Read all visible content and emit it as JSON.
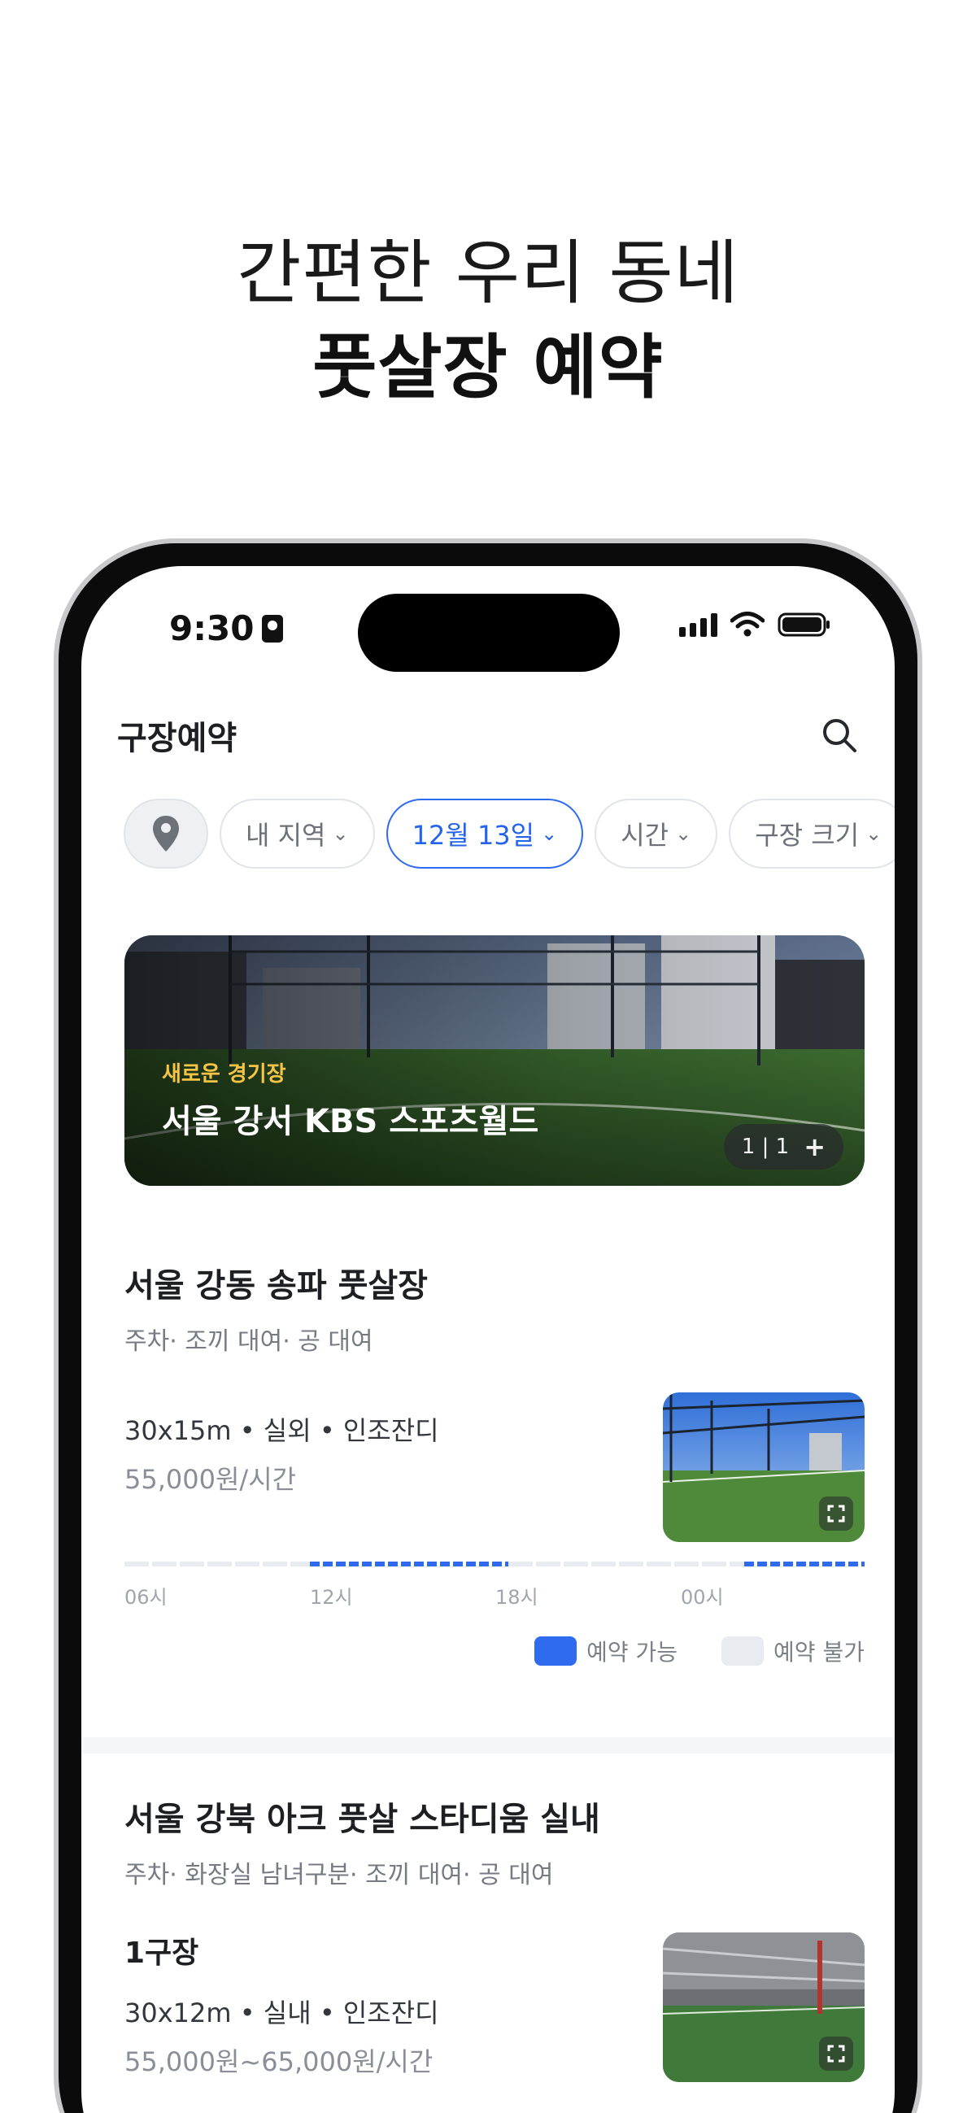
{
  "promo": {
    "line1": "간편한 우리 동네",
    "line2": "풋살장 예약"
  },
  "status_bar": {
    "time": "9:30"
  },
  "app": {
    "title": "구장예약",
    "filters": [
      {
        "label": "내 지역",
        "active": false
      },
      {
        "label": "12월 13일",
        "active": true
      },
      {
        "label": "시간",
        "active": false
      },
      {
        "label": "구장 크기",
        "active": false
      }
    ],
    "chevron": "⌄"
  },
  "banner": {
    "tag": "새로운 경기장",
    "name": "서울 강서 KBS 스포츠월드",
    "counter": "1 | 1",
    "plus": "+"
  },
  "venues": [
    {
      "name": "서울 강동 송파 풋살장",
      "amenities": "주차· 조끼 대여· 공 대여",
      "spec": "30x15m • 실외 • 인조잔디",
      "price": "55,000원/시간",
      "timeline_labels": [
        "06시",
        "12시",
        "18시",
        "00시"
      ],
      "legend": {
        "available": "예약 가능",
        "unavailable": "예약 불가"
      }
    },
    {
      "name": "서울 강북 아크 풋살 스타디움 실내",
      "amenities": "주차· 화장실 남녀구분· 조끼 대여· 공 대여",
      "court": "1구장",
      "spec": "30x12m • 실내 • 인조잔디",
      "price": "55,000원~65,000원/시간"
    }
  ],
  "colors": {
    "accent": "#2463eb",
    "available": "#2f6bef",
    "unavailable": "#e8ebef",
    "banner_tag": "#f6c545"
  },
  "icons": {
    "location": "map-pin-icon",
    "search": "search-icon",
    "expand": "expand-icon"
  }
}
